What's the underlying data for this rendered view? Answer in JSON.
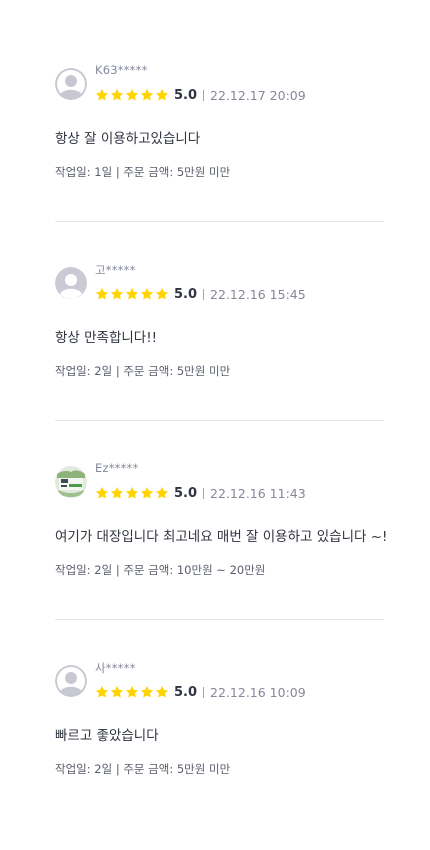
{
  "colors": {
    "star": "#ffd400",
    "divider": "#e4e5ed",
    "avatar_placeholder": "#c7c8d2"
  },
  "reviews": [
    {
      "user": "K63*****",
      "rating": "5.0",
      "rating_value": 5,
      "date": "22.12.17 20:09",
      "comment": "항상 잘 이용하고있습니다",
      "info": "작업일: 1일 | 주문 금액: 5만원 미만",
      "avatar": "default-avatar-icon"
    },
    {
      "user": "고*****",
      "rating": "5.0",
      "rating_value": 5,
      "date": "22.12.16 15:45",
      "comment": "항상 만족합니다!!",
      "info": "작업일: 2일 | 주문 금액: 5만원 미만",
      "avatar": "default-avatar-icon"
    },
    {
      "user": "Ez*****",
      "rating": "5.0",
      "rating_value": 5,
      "date": "22.12.16 11:43",
      "comment": "여기가 대장입니다 최고네요 매번 잘 이용하고 있습니다 ~!",
      "info": "작업일: 2일 | 주문 금액: 10만원 ~ 20만원",
      "avatar": "profile-photo"
    },
    {
      "user": "사*****",
      "rating": "5.0",
      "rating_value": 5,
      "date": "22.12.16 10:09",
      "comment": "빠르고 좋았습니다",
      "info": "작업일: 2일 | 주문 금액: 5만원 미만",
      "avatar": "default-avatar-icon"
    }
  ]
}
